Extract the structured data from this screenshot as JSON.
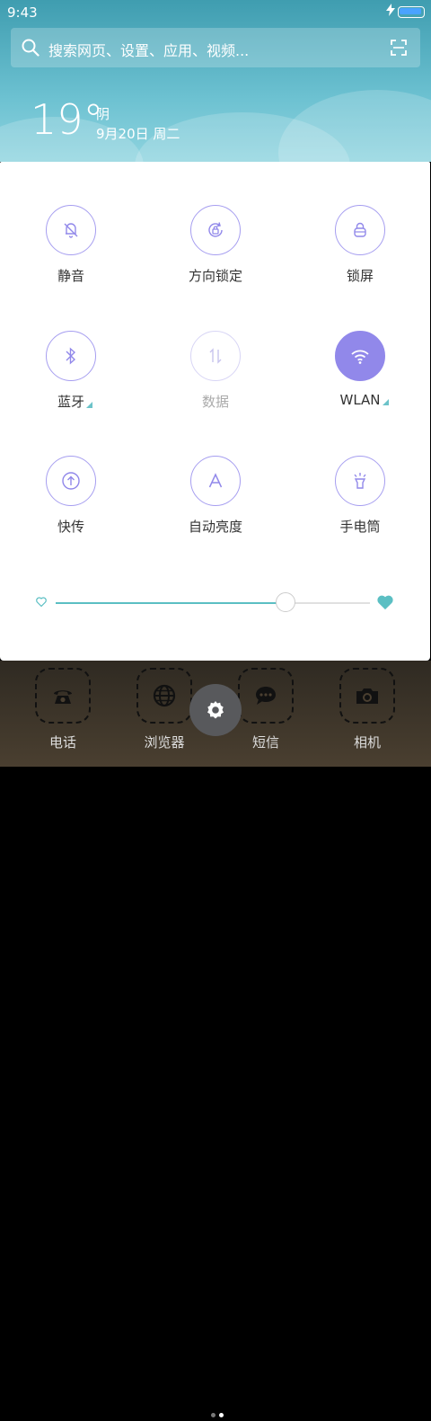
{
  "status_bar": {
    "time": "9:43"
  },
  "search": {
    "placeholder": "搜索网页、设置、应用、视频..."
  },
  "weather": {
    "temperature": "19°",
    "condition": "阴",
    "date": "9月20日 周二"
  },
  "toggles": [
    {
      "label": "静音",
      "icon": "bell-off-icon",
      "state": "off"
    },
    {
      "label": "方向锁定",
      "icon": "rotation-lock-icon",
      "state": "off"
    },
    {
      "label": "锁屏",
      "icon": "lock-icon",
      "state": "off"
    },
    {
      "label": "蓝牙",
      "icon": "bluetooth-icon",
      "state": "off"
    },
    {
      "label": "数据",
      "icon": "data-icon",
      "state": "disabled"
    },
    {
      "label": "WLAN",
      "icon": "wifi-icon",
      "state": "on"
    },
    {
      "label": "快传",
      "icon": "transfer-icon",
      "state": "off"
    },
    {
      "label": "自动亮度",
      "icon": "auto-brightness-icon",
      "state": "off"
    },
    {
      "label": "手电筒",
      "icon": "flashlight-icon",
      "state": "off"
    }
  ],
  "brightness": {
    "level": 0.73
  },
  "colors": {
    "accent": "#9188ea",
    "slider": "#5bbfc3",
    "sky": "#6cc1d1"
  },
  "dock": {
    "apps": [
      {
        "label": "电话",
        "icon": "phone-icon"
      },
      {
        "label": "浏览器",
        "icon": "globe-icon"
      },
      {
        "label": "短信",
        "icon": "message-icon"
      },
      {
        "label": "相机",
        "icon": "camera-icon"
      }
    ],
    "page_count": 2,
    "current_page": 2
  }
}
